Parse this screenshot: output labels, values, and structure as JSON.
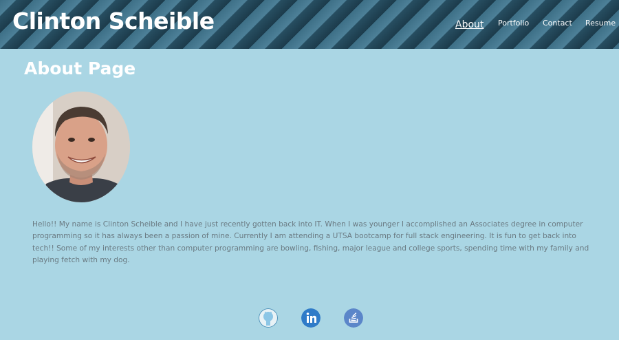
{
  "header": {
    "title": "Clinton Scheible",
    "nav": [
      {
        "label": "About",
        "active": true
      },
      {
        "label": "Portfolio",
        "active": false
      },
      {
        "label": "Contact",
        "active": false
      },
      {
        "label": "Resume",
        "active": false
      }
    ]
  },
  "main": {
    "heading": "About Page",
    "bio": "Hello!! My name is Clinton Scheible and I have just recently gotten back into IT. When I was younger I accomplished an Associates degree in computer programming so it has always been a passion of mine. Currently I am attending a UTSA bootcamp for full stack engineering. It is fun to get back into tech!! Some of my interests other than computer programming are bowling, fishing, major league and college sports, spending time with my family and playing fetch with my dog."
  },
  "footer": {
    "social_links": [
      {
        "name": "github",
        "icon": "github-icon"
      },
      {
        "name": "linkedin",
        "icon": "linkedin-icon"
      },
      {
        "name": "stackoverflow",
        "icon": "stackoverflow-icon"
      }
    ]
  },
  "colors": {
    "page_background": "#aad6e4",
    "header_stripe_dark": "#1c3b4b",
    "header_stripe_light": "#4d8098",
    "text_light": "#ffffff",
    "bio_text": "#6a7a82",
    "linkedin_blue": "#2f7bc8"
  }
}
